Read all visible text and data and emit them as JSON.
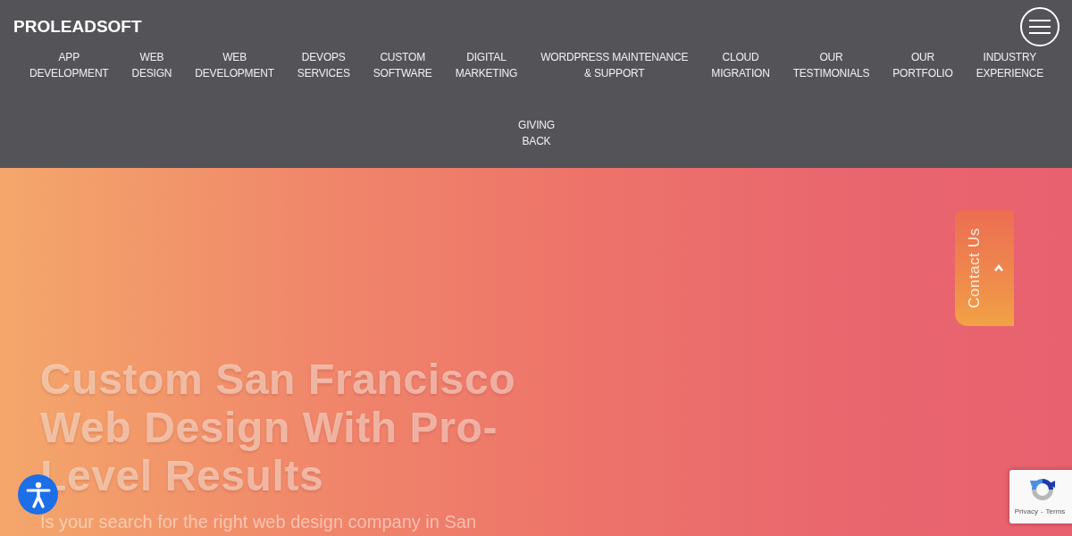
{
  "header": {
    "logo": "PROLEADSOFT",
    "nav": [
      {
        "label": "APP\nDEVELOPMENT"
      },
      {
        "label": "WEB\nDESIGN"
      },
      {
        "label": "WEB\nDEVELOPMENT"
      },
      {
        "label": "DEVOPS\nSERVICES"
      },
      {
        "label": "CUSTOM\nSOFTWARE"
      },
      {
        "label": "DIGITAL\nMARKETING"
      },
      {
        "label": "WORDPRESS MAINTENANCE\n& SUPPORT"
      },
      {
        "label": "CLOUD\nMIGRATION"
      },
      {
        "label": "OUR\nTESTIMONIALS"
      },
      {
        "label": "OUR\nPORTFOLIO"
      },
      {
        "label": "INDUSTRY\nEXPERIENCE"
      },
      {
        "label": "GIVING\nBACK"
      }
    ]
  },
  "hero": {
    "heading": "Custom San Francisco Web Design With Pro-Level Results",
    "paragraph": "Is your search for the right web design company in San"
  },
  "contact_tab": {
    "label": "Contact Us"
  },
  "recaptcha": {
    "privacy_link": "Privacy",
    "separator": "-",
    "terms_link": "Terms"
  }
}
